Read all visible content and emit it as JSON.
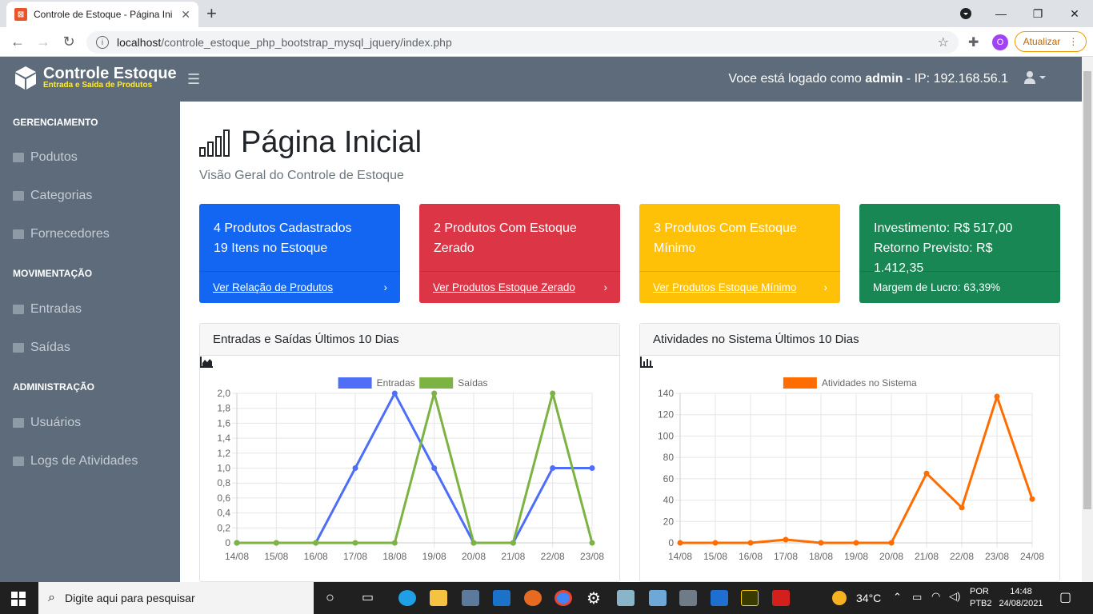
{
  "browser": {
    "tab_title": "Controle de Estoque - Página Ini",
    "url_host": "localhost",
    "url_path": "/controle_estoque_php_bootstrap_mysql_jquery/index.php",
    "profile_initial": "O",
    "update_label": "Atualizar"
  },
  "app": {
    "brand_name": "Controle Estoque",
    "brand_sub": "Entrada e Saída de Produtos",
    "logged_prefix": "Voce está logado como",
    "logged_user": "admin",
    "logged_ip": " - IP: 192.168.56.1"
  },
  "sidebar": {
    "sections": [
      {
        "title": "GERENCIAMENTO",
        "items": [
          "Podutos",
          "Categorias",
          "Fornecedores"
        ]
      },
      {
        "title": "MOVIMENTAÇÃO",
        "items": [
          "Entradas",
          "Saídas"
        ]
      },
      {
        "title": "ADMINISTRAÇÃO",
        "items": [
          "Usuários",
          "Logs de Atividades"
        ]
      }
    ]
  },
  "page": {
    "title": "Página Inicial",
    "subtitle": "Visão Geral do Controle de Estoque"
  },
  "cards": [
    {
      "line1": "4 Produtos Cadastrados",
      "line2": "19 Itens no Estoque",
      "footer": "Ver Relação de Produtos",
      "color": "#1266f1"
    },
    {
      "line1": "2 Produtos Com Estoque",
      "line2": "Zerado",
      "footer": "Ver Produtos Estoque Zerado",
      "color": "#dc3545"
    },
    {
      "line1": "3 Produtos Com Estoque",
      "line2": "Mínimo",
      "footer": "Ver Produtos Estoque Mínimo",
      "color": "#ffc107"
    },
    {
      "line1": "Investimento: R$ 517,00",
      "line2": "Retorno Previsto: R$ 1.412,35",
      "footer": "Margem de Lucro: 63,39%",
      "color": "#198754"
    }
  ],
  "panels": {
    "left_title": "Entradas e Saídas Últimos 10 Dias",
    "right_title": "Atividades no Sistema Últimos 10 Dias"
  },
  "chart_data": [
    {
      "type": "line",
      "categories": [
        "14/08",
        "15/08",
        "16/08",
        "17/08",
        "18/08",
        "19/08",
        "20/08",
        "21/08",
        "22/08",
        "23/08"
      ],
      "series": [
        {
          "name": "Entradas",
          "color": "#4f6ef7",
          "values": [
            0,
            0,
            0,
            1,
            2,
            1,
            0,
            0,
            1,
            1
          ]
        },
        {
          "name": "Saídas",
          "color": "#7cb342",
          "values": [
            0,
            0,
            0,
            0,
            0,
            2,
            0,
            0,
            2,
            0
          ]
        }
      ],
      "ylim": [
        0,
        2
      ],
      "yticks": [
        "0",
        "0,2",
        "0,4",
        "0,6",
        "0,8",
        "1,0",
        "1,2",
        "1,4",
        "1,6",
        "1,8",
        "2,0"
      ],
      "legend": "top",
      "grid": true
    },
    {
      "type": "line",
      "categories": [
        "14/08",
        "15/08",
        "16/08",
        "17/08",
        "18/08",
        "19/08",
        "20/08",
        "21/08",
        "22/08",
        "23/08",
        "24/08"
      ],
      "series": [
        {
          "name": "Atividades no Sistema",
          "color": "#ff6d00",
          "values": [
            0,
            0,
            0,
            3,
            0,
            0,
            0,
            65,
            33,
            137,
            41
          ]
        }
      ],
      "ylim": [
        0,
        140
      ],
      "yticks": [
        "0",
        "20",
        "40",
        "60",
        "80",
        "100",
        "120",
        "140"
      ],
      "legend": "top",
      "grid": true
    }
  ],
  "taskbar": {
    "search_placeholder": "Digite aqui para pesquisar",
    "weather": "34°C",
    "lang1": "POR",
    "lang2": "PTB2",
    "time": "14:48",
    "date": "24/08/2021"
  }
}
